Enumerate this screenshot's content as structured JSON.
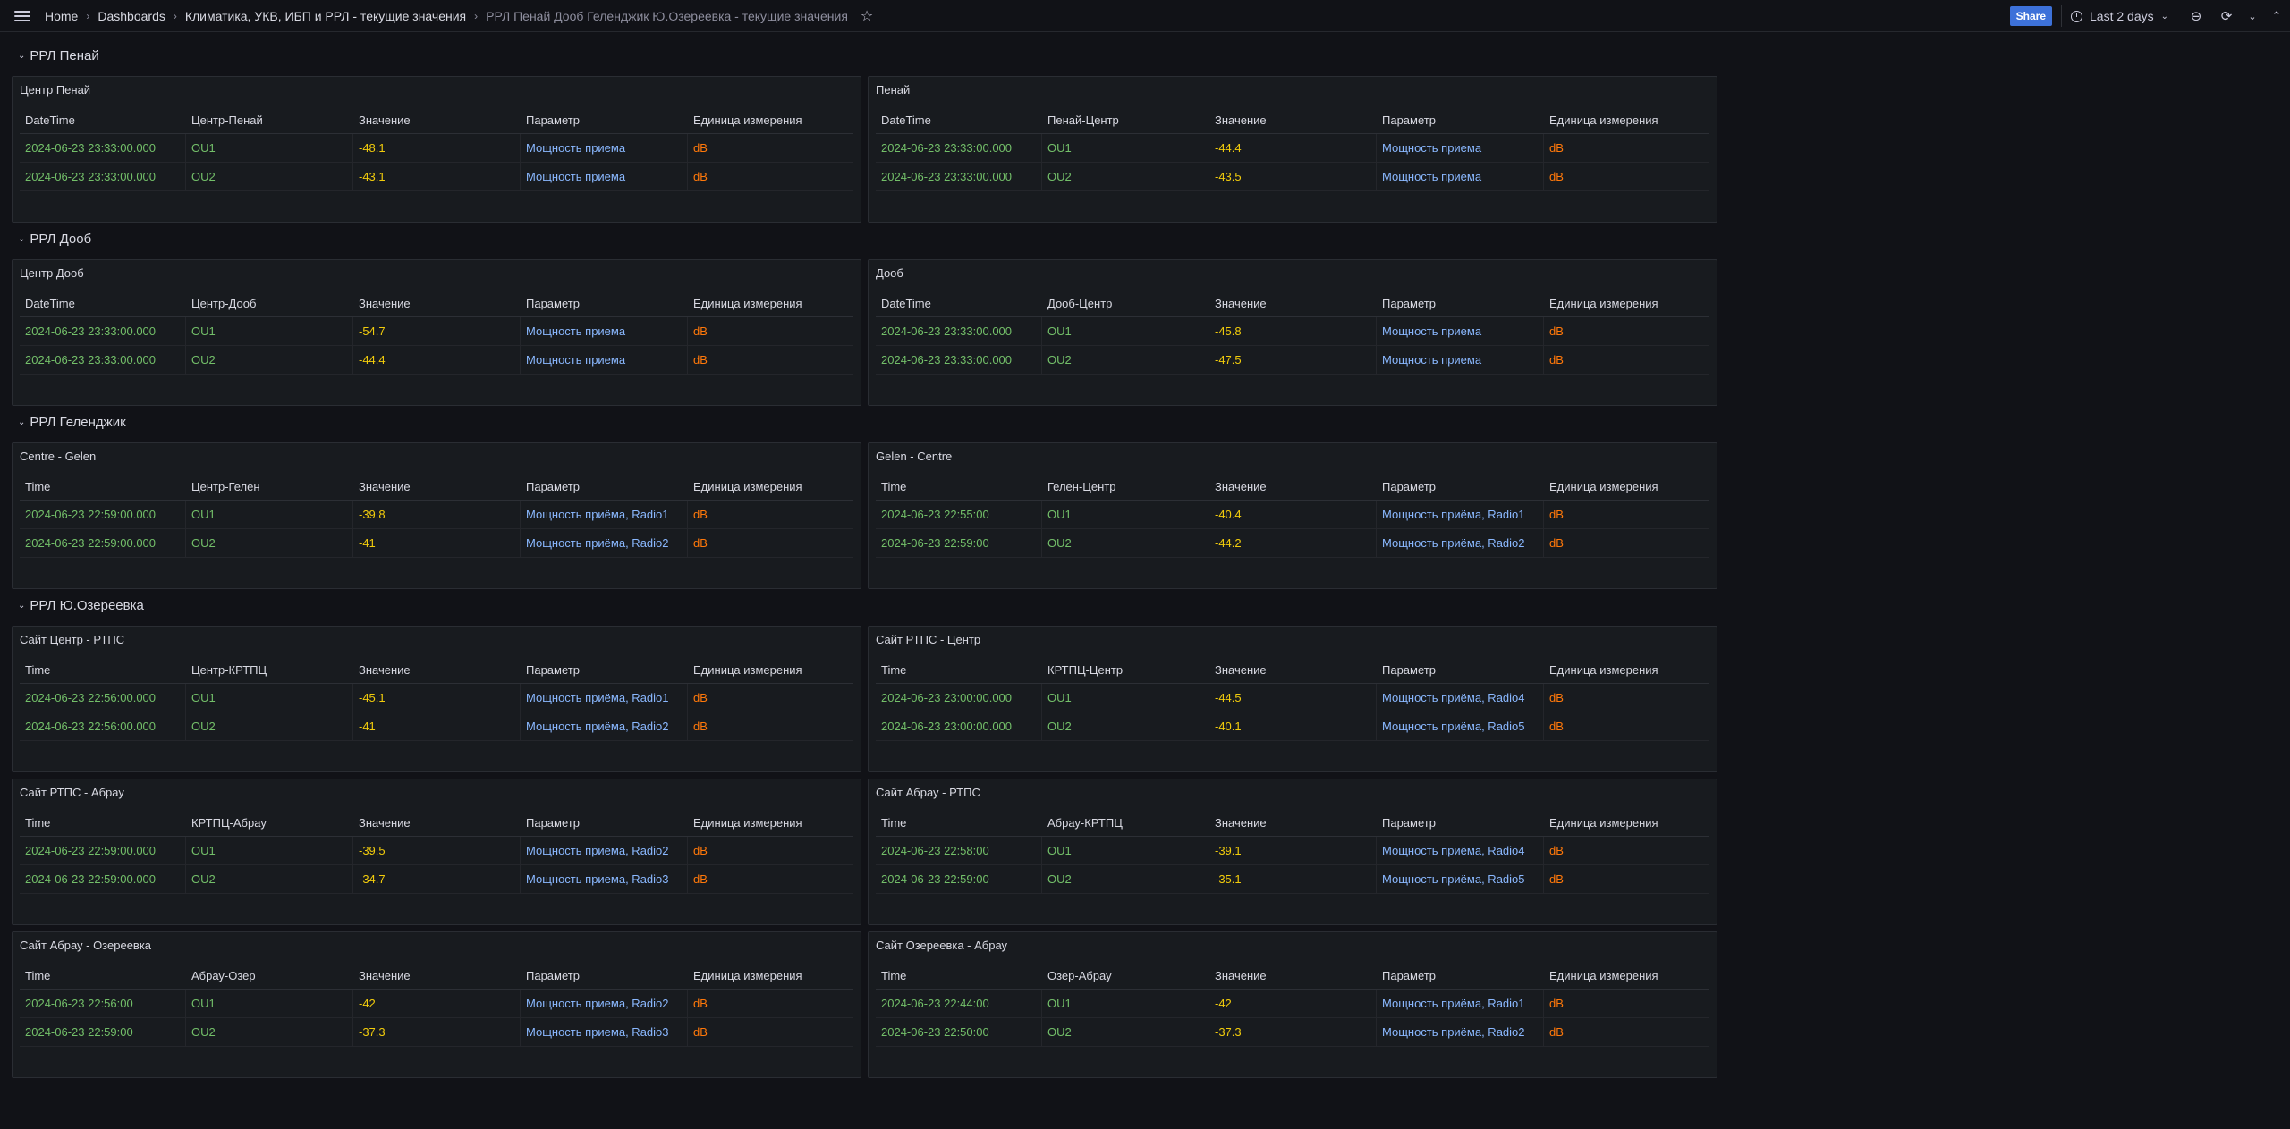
{
  "topbar": {
    "breadcrumbs": [
      "Home",
      "Dashboards",
      "Климатика, УКВ, ИБП и РРЛ - текущие значения",
      "РРЛ Пенай Дооб Геленджик Ю.Озереевка - текущие значения"
    ],
    "share_label": "Share",
    "time_range": "Last 2 days",
    "icons": [
      "menu-icon",
      "star-icon",
      "clock-icon",
      "zoom-out-icon",
      "refresh-icon",
      "chevron-down-icon",
      "chevron-up-icon"
    ]
  },
  "rows": [
    {
      "title": "РРЛ Пенай",
      "panels": [
        {
          "title": "Центр Пенай",
          "headers": [
            "DateTime",
            "Центр-Пенай",
            "Значение",
            "Параметр",
            "Единица измерения"
          ],
          "rows": [
            [
              "2024-06-23 23:33:00.000",
              "OU1",
              "-48.1",
              "Мощность приема",
              "dB"
            ],
            [
              "2024-06-23 23:33:00.000",
              "OU2",
              "-43.1",
              "Мощность приема",
              "dB"
            ]
          ]
        },
        {
          "title": "Пенай",
          "headers": [
            "DateTime",
            "Пенай-Центр",
            "Значение",
            "Параметр",
            "Единица измерения"
          ],
          "rows": [
            [
              "2024-06-23 23:33:00.000",
              "OU1",
              "-44.4",
              "Мощность приема",
              "dB"
            ],
            [
              "2024-06-23 23:33:00.000",
              "OU2",
              "-43.5",
              "Мощность приема",
              "dB"
            ]
          ]
        }
      ]
    },
    {
      "title": "РРЛ Дооб",
      "panels": [
        {
          "title": "Центр Дооб",
          "headers": [
            "DateTime",
            "Центр-Дооб",
            "Значение",
            "Параметр",
            "Единица измерения"
          ],
          "rows": [
            [
              "2024-06-23 23:33:00.000",
              "OU1",
              "-54.7",
              "Мощность приема",
              "dB"
            ],
            [
              "2024-06-23 23:33:00.000",
              "OU2",
              "-44.4",
              "Мощность приема",
              "dB"
            ]
          ]
        },
        {
          "title": "Дооб",
          "headers": [
            "DateTime",
            "Дооб-Центр",
            "Значение",
            "Параметр",
            "Единица измерения"
          ],
          "rows": [
            [
              "2024-06-23 23:33:00.000",
              "OU1",
              "-45.8",
              "Мощность приема",
              "dB"
            ],
            [
              "2024-06-23 23:33:00.000",
              "OU2",
              "-47.5",
              "Мощность приема",
              "dB"
            ]
          ]
        }
      ]
    },
    {
      "title": "РРЛ Геленджик",
      "panels": [
        {
          "title": "Centre - Gelen",
          "headers": [
            "Time",
            "Центр-Гелен",
            "Значение",
            "Параметр",
            "Единица измерения"
          ],
          "rows": [
            [
              "2024-06-23 22:59:00.000",
              "OU1",
              "-39.8",
              "Мощность приёма, Radio1",
              "dB"
            ],
            [
              "2024-06-23 22:59:00.000",
              "OU2",
              "-41",
              "Мощность приёма, Radio2",
              "dB"
            ]
          ]
        },
        {
          "title": "Gelen - Centre",
          "headers": [
            "Time",
            "Гелен-Центр",
            "Значение",
            "Параметр",
            "Единица измерения"
          ],
          "rows": [
            [
              "2024-06-23 22:55:00",
              "OU1",
              "-40.4",
              "Мощность приёма, Radio1",
              "dB"
            ],
            [
              "2024-06-23 22:59:00",
              "OU2",
              "-44.2",
              "Мощность приёма, Radio2",
              "dB"
            ]
          ]
        }
      ]
    },
    {
      "title": "РРЛ Ю.Озереевка",
      "panels": [
        {
          "title": "Сайт Центр - РТПС",
          "headers": [
            "Time",
            "Центр-КРТПЦ",
            "Значение",
            "Параметр",
            "Единица измерения"
          ],
          "rows": [
            [
              "2024-06-23 22:56:00.000",
              "OU1",
              "-45.1",
              "Мощность приёма, Radio1",
              "dB"
            ],
            [
              "2024-06-23 22:56:00.000",
              "OU2",
              "-41",
              "Мощность приёма, Radio2",
              "dB"
            ]
          ]
        },
        {
          "title": "Сайт РТПС - Центр",
          "headers": [
            "Time",
            "КРТПЦ-Центр",
            "Значение",
            "Параметр",
            "Единица измерения"
          ],
          "rows": [
            [
              "2024-06-23 23:00:00.000",
              "OU1",
              "-44.5",
              "Мощность приёма, Radio4",
              "dB"
            ],
            [
              "2024-06-23 23:00:00.000",
              "OU2",
              "-40.1",
              "Мощность приёма, Radio5",
              "dB"
            ]
          ]
        },
        {
          "title": "Сайт РТПС - Абрау",
          "headers": [
            "Time",
            "КРТПЦ-Абрау",
            "Значение",
            "Параметр",
            "Единица измерения"
          ],
          "rows": [
            [
              "2024-06-23 22:59:00.000",
              "OU1",
              "-39.5",
              "Мощность приема, Radio2",
              "dB"
            ],
            [
              "2024-06-23 22:59:00.000",
              "OU2",
              "-34.7",
              "Мощность приема, Radio3",
              "dB"
            ]
          ]
        },
        {
          "title": "Сайт Абрау - РТПС",
          "headers": [
            "Time",
            "Абрау-КРТПЦ",
            "Значение",
            "Параметр",
            "Единица измерения"
          ],
          "rows": [
            [
              "2024-06-23 22:58:00",
              "OU1",
              "-39.1",
              "Мощность приёма, Radio4",
              "dB"
            ],
            [
              "2024-06-23 22:59:00",
              "OU2",
              "-35.1",
              "Мощность приёма, Radio5",
              "dB"
            ]
          ]
        },
        {
          "title": "Сайт Абрау - Озереевка",
          "headers": [
            "Time",
            "Абрау-Озер",
            "Значение",
            "Параметр",
            "Единица измерения"
          ],
          "rows": [
            [
              "2024-06-23 22:56:00",
              "OU1",
              "-42",
              "Мощность приема, Radio2",
              "dB"
            ],
            [
              "2024-06-23 22:59:00",
              "OU2",
              "-37.3",
              "Мощность приема, Radio3",
              "dB"
            ]
          ]
        },
        {
          "title": "Сайт Озереевка - Абрау",
          "headers": [
            "Time",
            "Озер-Абрау",
            "Значение",
            "Параметр",
            "Единица измерения"
          ],
          "rows": [
            [
              "2024-06-23 22:44:00",
              "OU1",
              "-42",
              "Мощность приёма, Radio1",
              "dB"
            ],
            [
              "2024-06-23 22:50:00",
              "OU2",
              "-37.3",
              "Мощность приёма, Radio2",
              "dB"
            ]
          ]
        }
      ]
    }
  ]
}
